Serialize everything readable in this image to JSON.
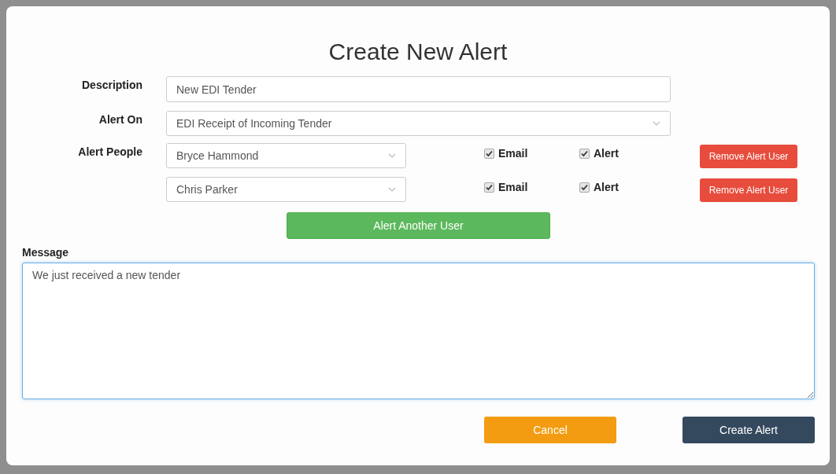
{
  "title": "Create New Alert",
  "description": {
    "label": "Description",
    "value": "New EDI Tender"
  },
  "alert_on": {
    "label": "Alert On",
    "value": "EDI Receipt of Incoming Tender"
  },
  "alert_people": {
    "label": "Alert People",
    "people": [
      {
        "name": "Bryce Hammond",
        "email_label": "Email",
        "email_checked": true,
        "alert_label": "Alert",
        "alert_checked": true,
        "remove_button": "Remove Alert User"
      },
      {
        "name": "Chris Parker",
        "email_label": "Email",
        "email_checked": true,
        "alert_label": "Alert",
        "alert_checked": true,
        "remove_button": "Remove Alert User"
      }
    ]
  },
  "add_button": "Alert Another User",
  "message": {
    "label": "Message",
    "value": "We just received a new tender"
  },
  "buttons": {
    "cancel": "Cancel",
    "create": "Create Alert"
  }
}
